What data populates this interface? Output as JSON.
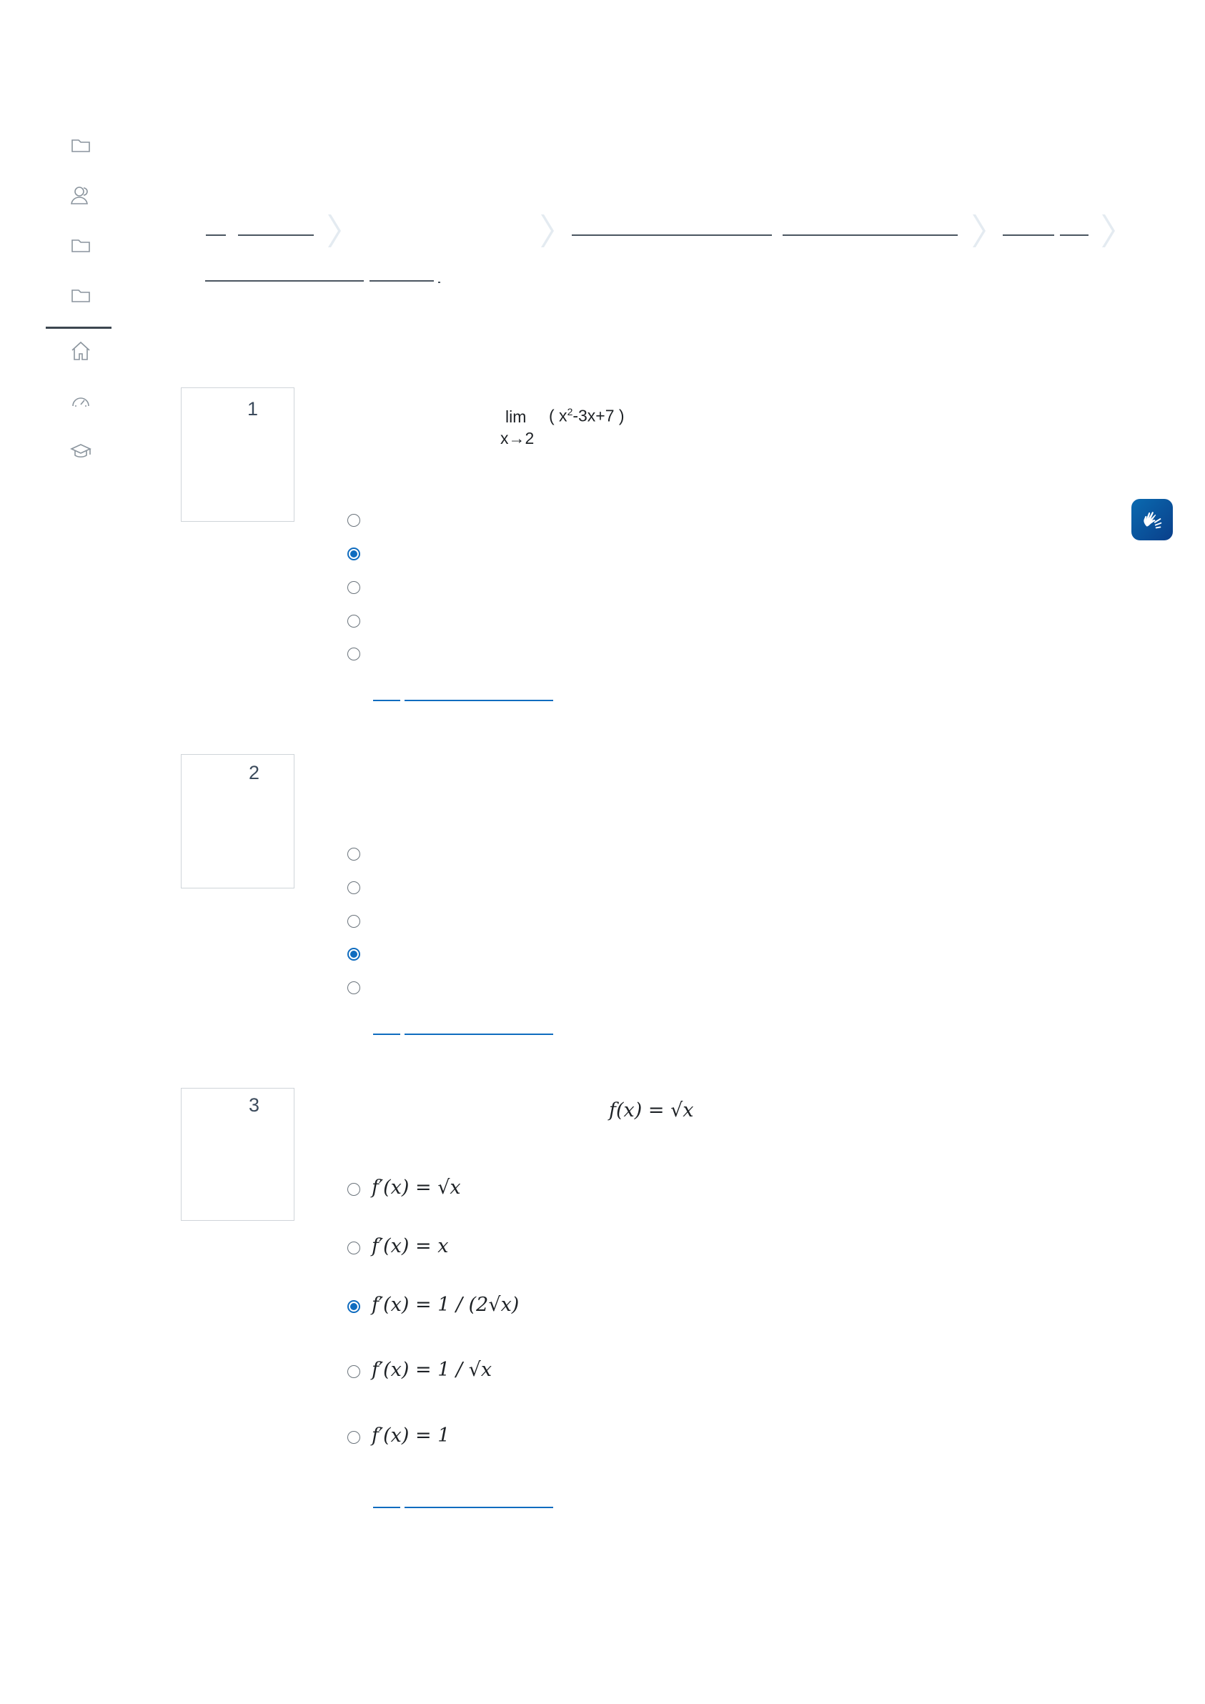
{
  "nav": {
    "items": [
      {
        "name": "folder-icon"
      },
      {
        "name": "users-icon"
      },
      {
        "name": "folder-icon"
      },
      {
        "name": "folder-icon"
      },
      {
        "name": "home-icon"
      },
      {
        "name": "dashboard-icon"
      },
      {
        "name": "graduation-cap-icon"
      }
    ]
  },
  "questions": [
    {
      "number": "1",
      "limit_word": "lim",
      "limit_sub": "x→2",
      "limit_expr_open": "( x",
      "limit_expr_sup": "2",
      "limit_expr_rest": "-3x+7 )",
      "selected_option": 2,
      "option_count": 5
    },
    {
      "number": "2",
      "selected_option": 4,
      "option_count": 5
    },
    {
      "number": "3",
      "function": "f(x) = √x",
      "options": [
        "f′(x) = √x",
        "f′(x) = x",
        "f′(x) = 1 / (2√x)",
        "f′(x) = 1 / √x",
        "f′(x) = 1"
      ],
      "selected_option": 3
    }
  ],
  "colors": {
    "accent": "#0f6cbf",
    "rail_icon": "#8a949d",
    "breadcrumb_line": "#4a5560",
    "a11y_button": "#0a5aa0"
  }
}
